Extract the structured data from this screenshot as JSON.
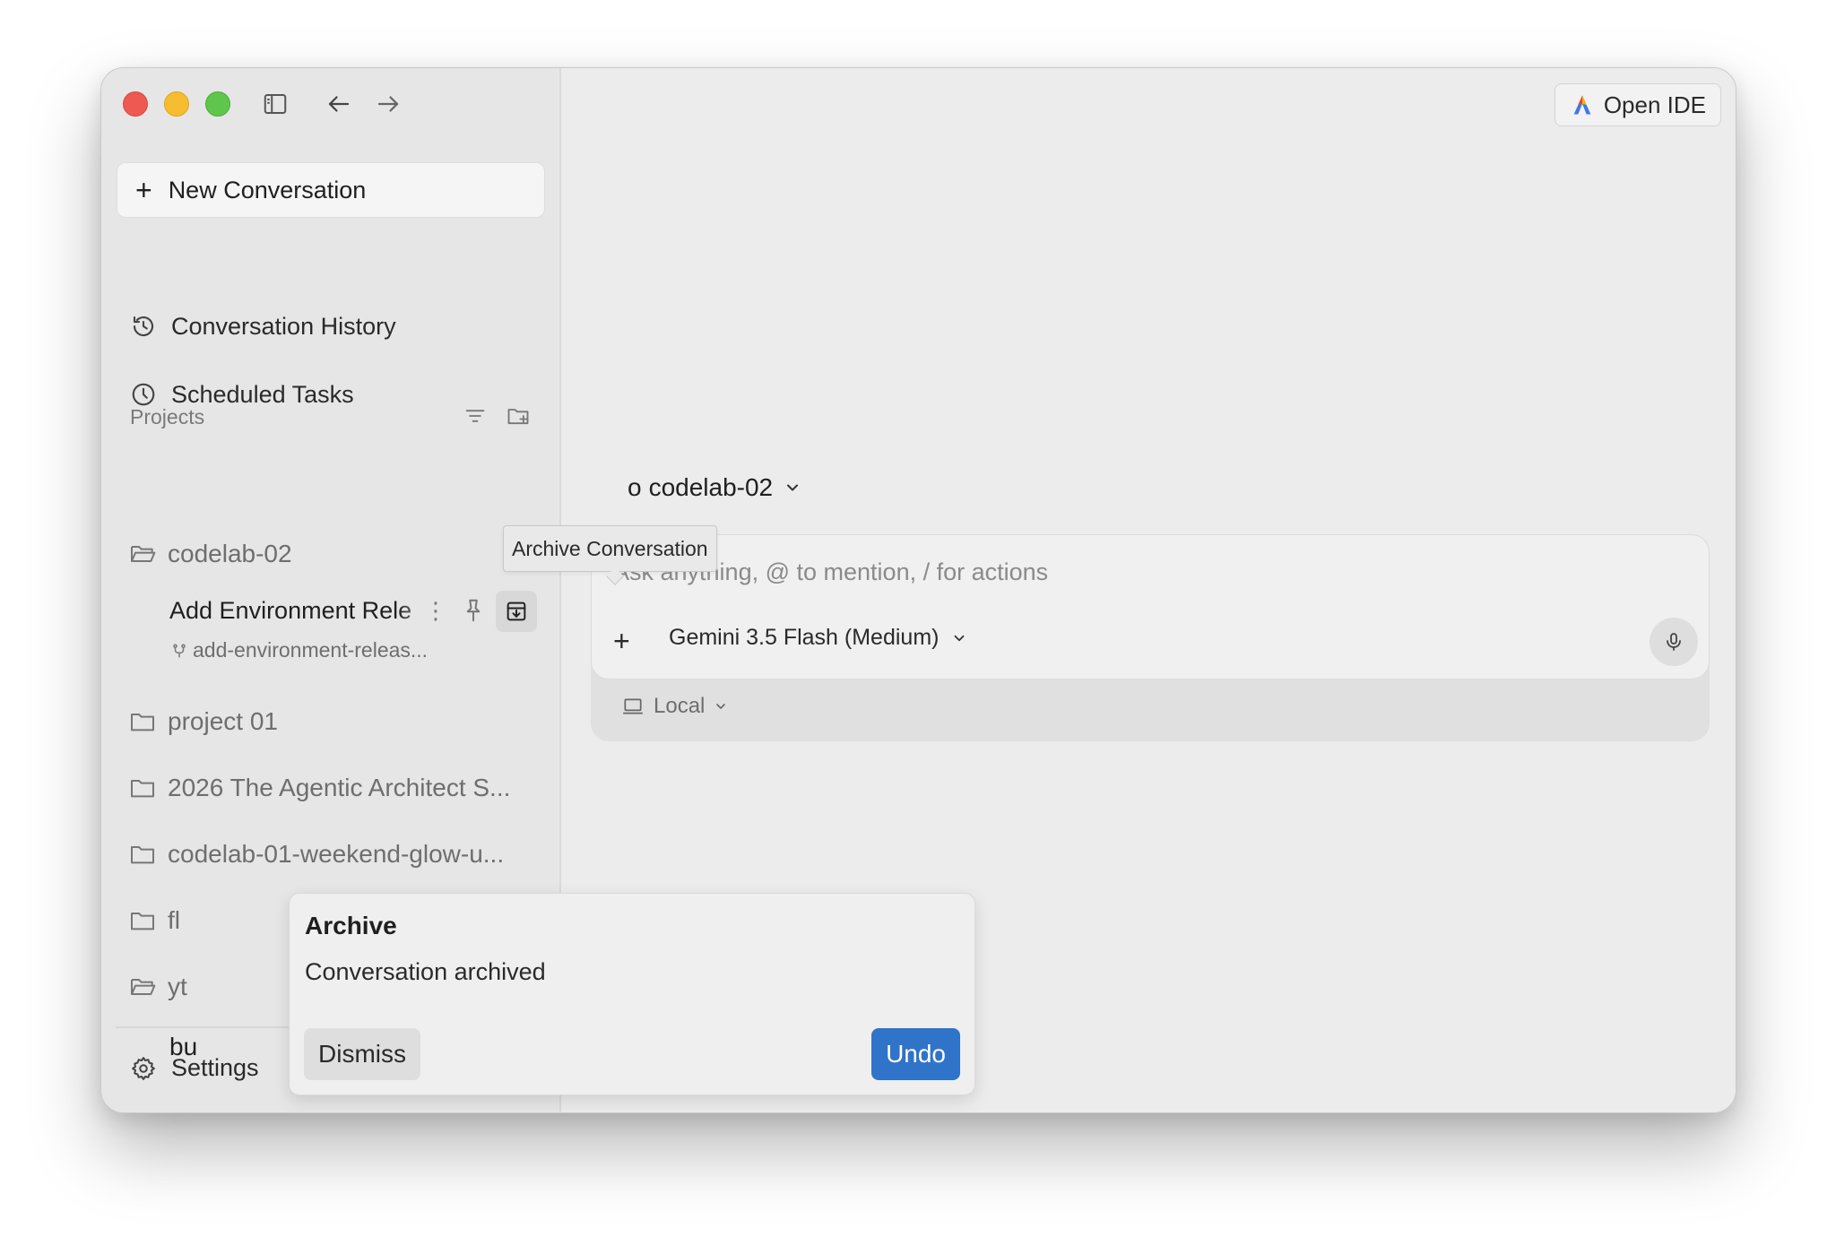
{
  "sidebar": {
    "new_conversation": "New Conversation",
    "conversation_history": "Conversation History",
    "scheduled_tasks": "Scheduled Tasks",
    "projects_label": "Projects",
    "projects": [
      {
        "name": "codelab-02"
      },
      {
        "name": "project 01"
      },
      {
        "name": "2026 The Agentic Architect S..."
      },
      {
        "name": "codelab-01-weekend-glow-u..."
      },
      {
        "name": "fl"
      },
      {
        "name": "yt"
      }
    ],
    "conversation": {
      "title": "Add Environment Rele",
      "branch": "add-environment-releas...",
      "partial_item": "bu"
    },
    "settings": "Settings"
  },
  "header": {
    "open_ide": "Open IDE"
  },
  "main": {
    "workspace_prefix": "o",
    "workspace": "codelab-02",
    "composer": {
      "placeholder": "Ask anything, @ to mention, / for actions",
      "model": "Gemini 3.5 Flash (Medium)",
      "environment": "Local"
    }
  },
  "tooltip": "Archive Conversation",
  "toast": {
    "title": "Archive",
    "message": "Conversation archived",
    "dismiss": "Dismiss",
    "undo": "Undo"
  },
  "colors": {
    "accent": "#2f74c8",
    "close": "#ee5a52",
    "minimize": "#f5bd2f",
    "zoom": "#5ec64c"
  }
}
